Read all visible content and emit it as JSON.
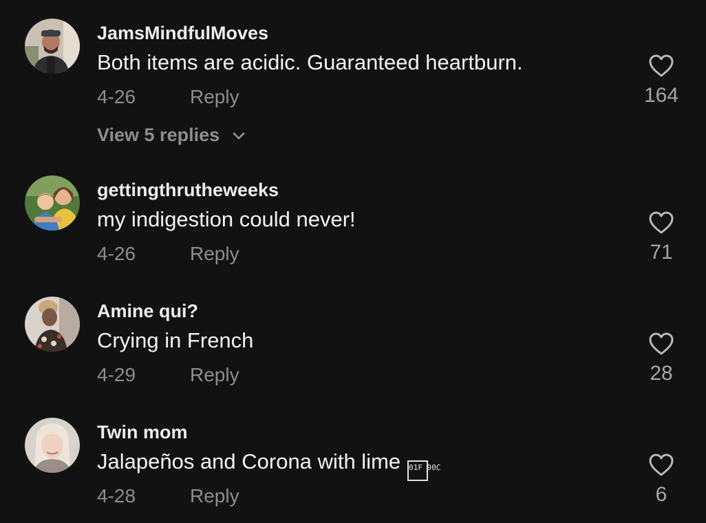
{
  "comments": [
    {
      "username": "JamsMindfulMoves",
      "text": "Both items are acidic. Guaranteed heartburn.",
      "date": "4-26",
      "reply_label": "Reply",
      "likes": "164",
      "view_replies": "View 5 replies",
      "avatar_icon": "avatar-photo-man-with-cap"
    },
    {
      "username": "gettingthrutheweeks",
      "text": "my indigestion could never!",
      "date": "4-26",
      "reply_label": "Reply",
      "likes": "71",
      "avatar_icon": "avatar-photo-mother-and-child"
    },
    {
      "username": "Amine qui?",
      "text": "Crying in French",
      "date": "4-29",
      "reply_label": "Reply",
      "likes": "28",
      "avatar_icon": "avatar-photo-person-with-hat"
    },
    {
      "username": "Twin mom",
      "text": "Jalapeños and Corona with lime",
      "emoji_placeholder": "01F 90C",
      "date": "4-28",
      "reply_label": "Reply",
      "likes": "6",
      "avatar_icon": "avatar-photo-blonde-woman"
    }
  ],
  "colors": {
    "background": "#121212",
    "username": "#ecedef",
    "text": "#f2f2f2",
    "muted": "#8d8d8f",
    "like_count": "#a6a6a8"
  }
}
